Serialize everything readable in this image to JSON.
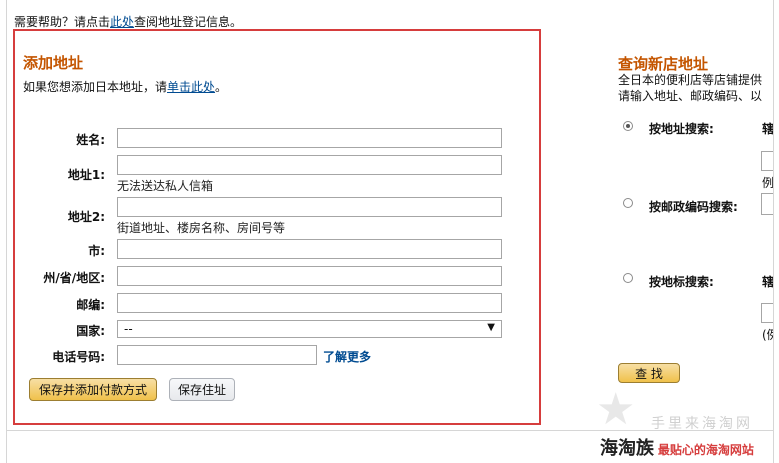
{
  "help": {
    "prefix": "需要帮助？请点击",
    "link": "此处",
    "suffix": "查阅地址登记信息。"
  },
  "add_address": {
    "title": "添加地址",
    "intro_prefix": "如果您想添加日本地址，请",
    "intro_link": "单击此处",
    "intro_suffix": "。",
    "fields": {
      "name": {
        "label": "姓名:",
        "value": ""
      },
      "address1": {
        "label": "地址1:",
        "value": "",
        "hint": "无法送达私人信箱"
      },
      "address2": {
        "label": "地址2:",
        "value": "",
        "hint": "街道地址、楼房名称、房间号等"
      },
      "city": {
        "label": "市:",
        "value": ""
      },
      "state": {
        "label": "州/省/地区:",
        "value": ""
      },
      "postal": {
        "label": "邮编:",
        "value": ""
      },
      "country": {
        "label": "国家:",
        "selected": "--"
      },
      "phone": {
        "label": "电话号码:",
        "value": "",
        "learn_more": "了解更多"
      }
    },
    "buttons": {
      "save_payment": "保存并添加付款方式",
      "save_address": "保存住址"
    }
  },
  "find_store": {
    "title": "查询新店地址",
    "desc_line1": "全日本的便利店等店铺提供",
    "desc_line2": "请输入地址、邮政编码、以",
    "options": [
      {
        "label": "按地址搜索:",
        "selected": true,
        "extra": "辖",
        "example": "例"
      },
      {
        "label": "按邮政编码搜索:",
        "selected": false
      },
      {
        "label": "按地标搜索:",
        "selected": false,
        "extra": "辖",
        "example": "(例"
      }
    ],
    "search_button": "查 找"
  },
  "watermark": {
    "top": "手里来海淘网",
    "brand": "海淘族",
    "slogan": "最贴心的海淘网站"
  },
  "colors": {
    "accent": "#c45500",
    "highlight_border": "#d63d3d",
    "link": "#004b91",
    "button": "#f0c14b"
  }
}
